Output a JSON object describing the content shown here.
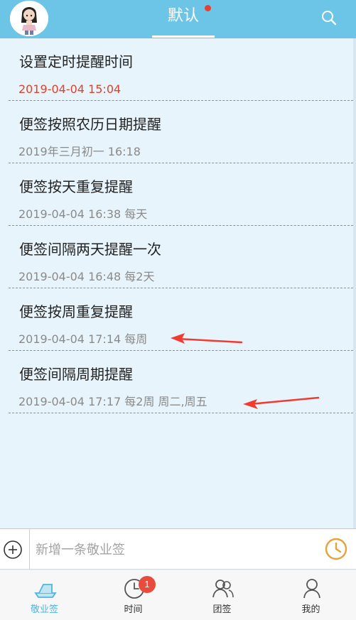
{
  "header": {
    "title": "默认"
  },
  "notes": [
    {
      "title": "设置定时提醒时间",
      "time": "2019-04-04 15:04"
    },
    {
      "title": "便签按照农历日期提醒",
      "time": "2019年三月初一 16:18"
    },
    {
      "title": "便签按天重复提醒",
      "time": "2019-04-04 16:38  每天"
    },
    {
      "title": "便签间隔两天提醒一次",
      "time": "2019-04-04 16:48  每2天"
    },
    {
      "title": "便签按周重复提醒",
      "time": "2019-04-04 17:14  每周"
    },
    {
      "title": "便签间隔周期提醒",
      "time": "2019-04-04 17:17  每2周  周二,周五"
    }
  ],
  "input": {
    "placeholder": "新增一条敬业签"
  },
  "tabs": [
    {
      "label": "敬业签",
      "icon": "boat-icon",
      "active": true
    },
    {
      "label": "时间",
      "icon": "clock-icon",
      "badge": "1"
    },
    {
      "label": "团签",
      "icon": "team-icon"
    },
    {
      "label": "我的",
      "icon": "profile-icon"
    }
  ],
  "colors": {
    "header": "#6cc5e6",
    "list_background": "#e8f4fb",
    "overdue_time": "#d9432f",
    "active_tab": "#51b5dc",
    "badge": "#e74c3c",
    "annotation_arrow": "#f03a32"
  }
}
